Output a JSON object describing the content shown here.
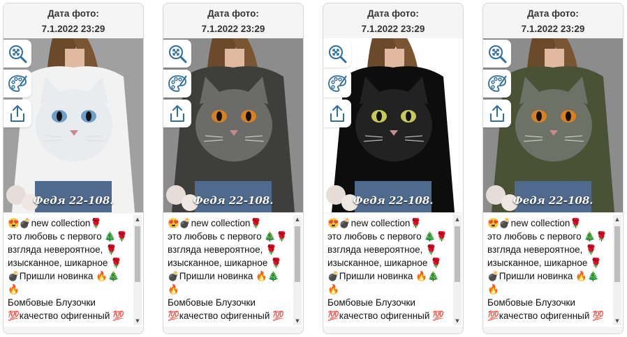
{
  "cards": [
    {
      "date_label": "Дата фото:",
      "date_value": "7.1.2022 23:29",
      "watermark": "Федя 22-108.",
      "sweater_color": "#f2f2f2",
      "cat_color": "#e9ecef",
      "eye_color": "#6f9fc9",
      "bg_color": "#a0a0a0",
      "description": [
        "😍💣new collection🌹",
        "это любовь с первого 🎄🌹",
        "взгляда невероятное, 🌹",
        "изысканное, шикарное 🌹",
        "💣Пришли новинка 🔥🎄",
        "🔥",
        "Бомбовые Блузочки",
        "💯качество офигенный 💯"
      ]
    },
    {
      "date_label": "Дата фото:",
      "date_value": "7.1.2022 23:29",
      "watermark": "Федя 22-108.",
      "sweater_color": "#3e3f3c",
      "cat_color": "#6b6b69",
      "eye_color": "#d9801f",
      "bg_color": "#8c8c8c",
      "description": [
        "😍💣new collection🌹",
        "это любовь с первого 🎄🌹",
        "взгляда невероятное, 🌹",
        "изысканное, шикарное 🌹",
        "💣Пришли новинка 🔥🎄",
        "🔥",
        "Бомбовые Блузочки",
        "💯качество офигенный 💯"
      ]
    },
    {
      "date_label": "Дата фото:",
      "date_value": "7.1.2022 23:29",
      "watermark": "Федя 22-108.",
      "sweater_color": "#0d0d0d",
      "cat_color": "#222222",
      "eye_color": "#c9c95a",
      "bg_color": "#ffffff",
      "description": [
        "😍💣new collection🌹",
        "это любовь с первого 🎄🌹",
        "взгляда невероятное, 🌹",
        "изысканное, шикарное 🌹",
        "💣Пришли новинка 🔥🎄",
        "🔥",
        "Бомбовые Блузочки",
        "💯качество офигенный 💯"
      ]
    },
    {
      "date_label": "Дата фото:",
      "date_value": "7.1.2022 23:29",
      "watermark": "Федя 22-108.",
      "sweater_color": "#4a5236",
      "cat_color": "#6e7266",
      "eye_color": "#d9801f",
      "bg_color": "#8c8c8c",
      "description": [
        "😍💣new collection🌹",
        "это любовь с первого 🎄🌹",
        "взгляда невероятное, 🌹",
        "изысканное, шикарное 🌹",
        "💣Пришли новинка 🔥🎄",
        "🔥",
        "Бомбовые Блузочки",
        "💯качество офигенный 💯"
      ]
    }
  ],
  "tools": [
    {
      "icon": "zoom-icon"
    },
    {
      "icon": "palette-icon"
    },
    {
      "icon": "share-icon"
    }
  ]
}
